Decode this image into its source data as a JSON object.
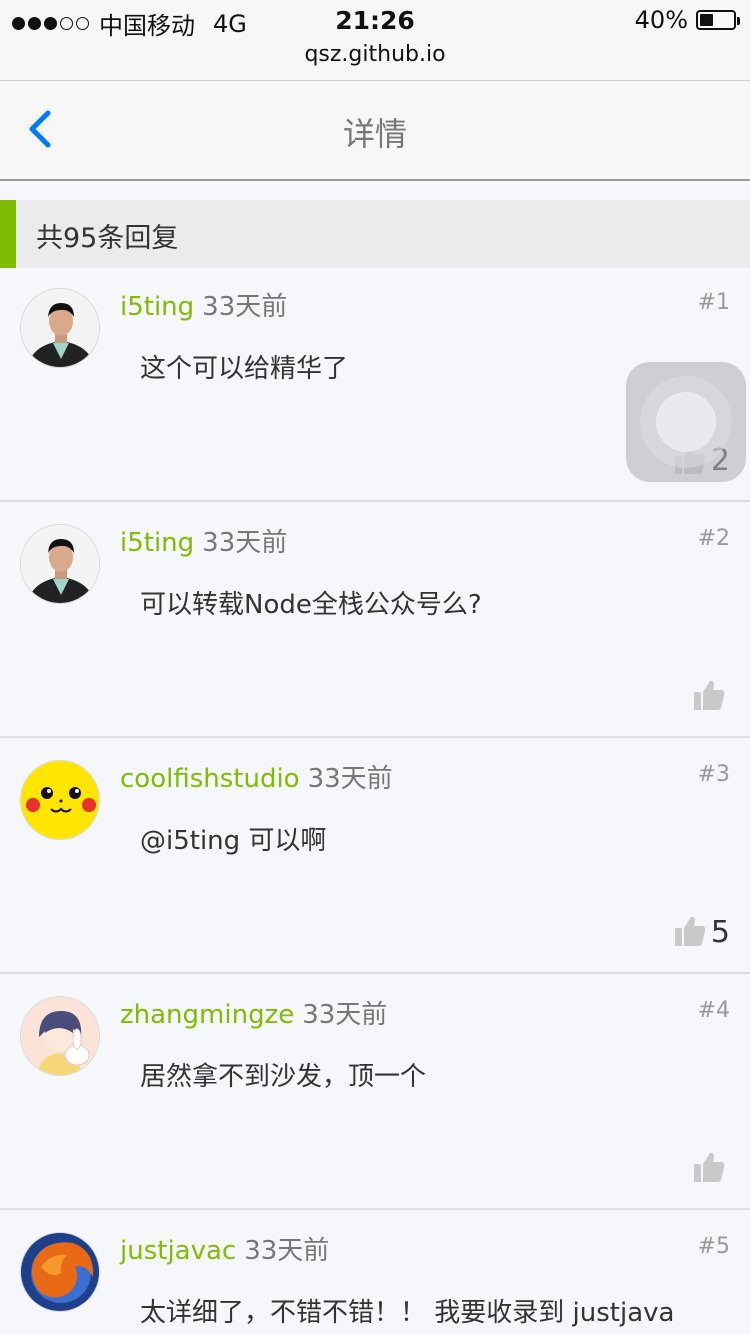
{
  "status_bar": {
    "carrier": "中国移动",
    "network": "4G",
    "time": "21:26",
    "battery": "40%",
    "battery_level": 0.4,
    "url": "qsz.github.io"
  },
  "nav": {
    "title": "详情",
    "back_icon": "chevron-left-icon",
    "accent_color": "#007aff"
  },
  "replies_header": "共95条回复",
  "colors": {
    "brand_green": "#80bd01",
    "text": "#333333"
  },
  "replies": [
    {
      "author": "i5ting",
      "time": "33天前",
      "floor": "#1",
      "content": "这个可以给精华了",
      "likes": "2"
    },
    {
      "author": "i5ting",
      "time": "33天前",
      "floor": "#2",
      "content": "可以转载Node全栈公众号么?",
      "likes": ""
    },
    {
      "author": "coolfishstudio",
      "time": "33天前",
      "floor": "#3",
      "content": "@i5ting 可以啊",
      "likes": "5"
    },
    {
      "author": "zhangmingze",
      "time": "33天前",
      "floor": "#4",
      "content": "居然拿不到沙发，顶一个",
      "likes": ""
    },
    {
      "author": "justjavac",
      "time": "33天前",
      "floor": "#5",
      "content": "太详细了，不错不错！！ 我要收录到 justjava",
      "likes": ""
    }
  ]
}
